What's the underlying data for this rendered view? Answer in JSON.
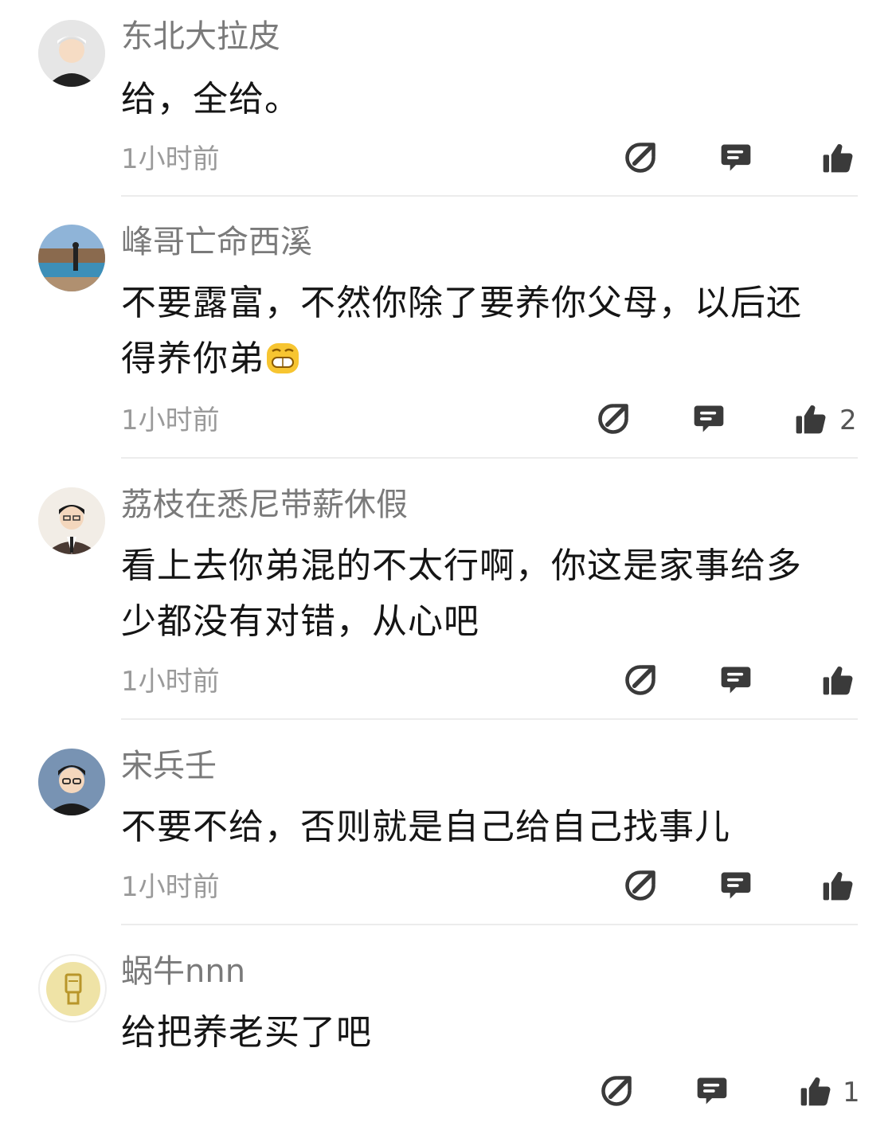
{
  "comments": [
    {
      "username": "东北大拉皮",
      "text": "给，全给。",
      "time": "1小时前",
      "likes": ""
    },
    {
      "username": "峰哥亡命西溪",
      "text_line1": "不要露富，不然你除了要养你父母，以后还",
      "text_line2": "得养你弟",
      "time": "1小时前",
      "likes": "2"
    },
    {
      "username": "荔枝在悉尼带薪休假",
      "text_line1": "看上去你弟混的不太行啊，你这是家事给多",
      "text_line2": "少都没有对错，从心吧",
      "time": "1小时前",
      "likes": ""
    },
    {
      "username": "宋兵壬",
      "text": "不要不给，否则就是自己给自己找事儿",
      "time": "1小时前",
      "likes": ""
    },
    {
      "username": "蜗牛nnn",
      "text": "给把养老买了吧",
      "likes": "1"
    }
  ],
  "icons": {
    "share": "share-icon",
    "reply": "comment-icon",
    "like": "thumbs-up-icon",
    "emoji": "grinning-face-emoji"
  },
  "colors": {
    "icon": "#3a3a3a",
    "username": "#7a7a7a",
    "timestamp": "#9a9a9a",
    "divider": "#ececec"
  }
}
